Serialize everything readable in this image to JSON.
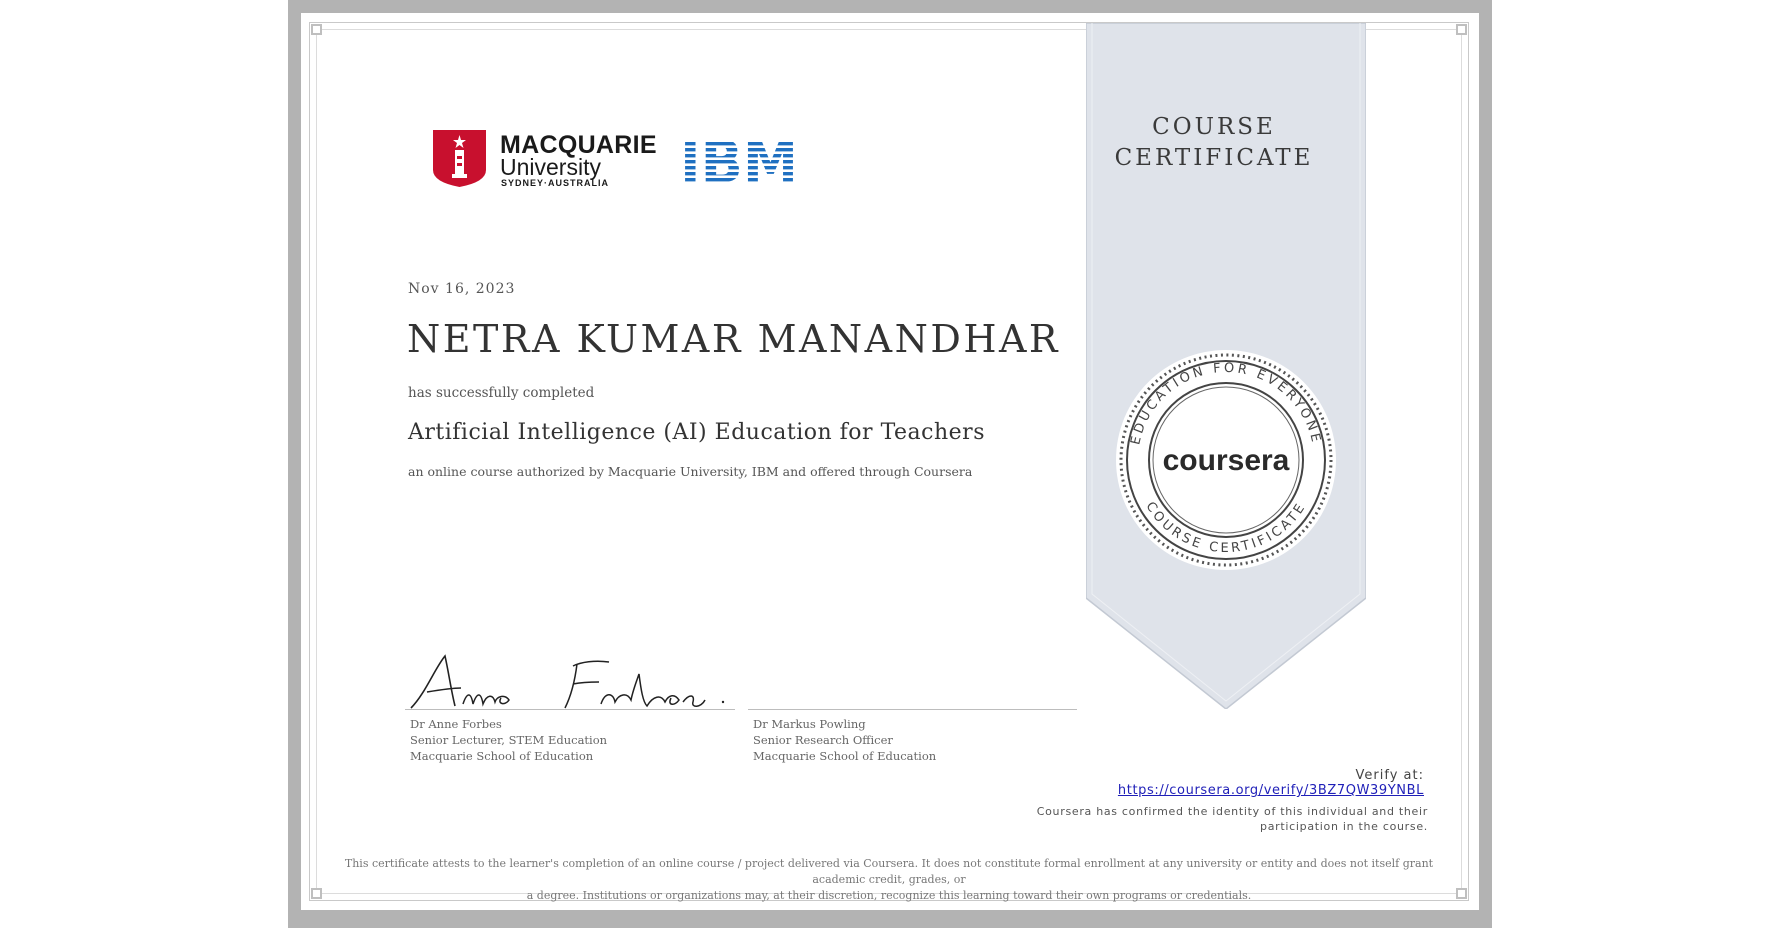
{
  "ribbon": {
    "title_line1": "COURSE",
    "title_line2": "CERTIFICATE",
    "seal_ring_top": "EDUCATION FOR EVERYONE",
    "seal_ring_bottom": "COURSE CERTIFICATE",
    "seal_brand": "coursera"
  },
  "logos": {
    "macquarie_line1": "MACQUARIE",
    "macquarie_line2": "University",
    "macquarie_line3": "SYDNEY·AUSTRALIA",
    "ibm": "IBM"
  },
  "certificate": {
    "date": "Nov 16, 2023",
    "recipient": "NETRA KUMAR MANANDHAR",
    "completed_text": "has successfully completed",
    "course_name": "Artificial Intelligence (AI) Education for Teachers",
    "authorized_text": "an online course authorized by Macquarie University, IBM and offered through Coursera"
  },
  "signatures": [
    {
      "name": "Dr Anne Forbes",
      "title": "Senior Lecturer, STEM Education",
      "org": "Macquarie School of Education"
    },
    {
      "name": "Dr Markus Powling",
      "title": "Senior Research Officer",
      "org": "Macquarie School of Education"
    }
  ],
  "verify": {
    "label": "Verify at:",
    "url": "https://coursera.org/verify/3BZ7QW39YNBL",
    "identity_line1": "Coursera has confirmed the identity of this individual and their",
    "identity_line2": "participation in the course."
  },
  "disclaimer": {
    "line1": "This certificate attests to the learner's completion of an online course / project delivered via Coursera. It does not constitute formal enrollment at any university or entity and does not itself grant academic credit, grades, or",
    "line2": "a degree. Institutions or organizations may, at their discretion, recognize this learning toward their own programs or credentials."
  },
  "colors": {
    "frame": "#b3b3b3",
    "ribbon": "#dfe3ea",
    "macquarie_red": "#c8102e",
    "ibm_blue": "#1f70c1",
    "link": "#1f1fb8"
  }
}
